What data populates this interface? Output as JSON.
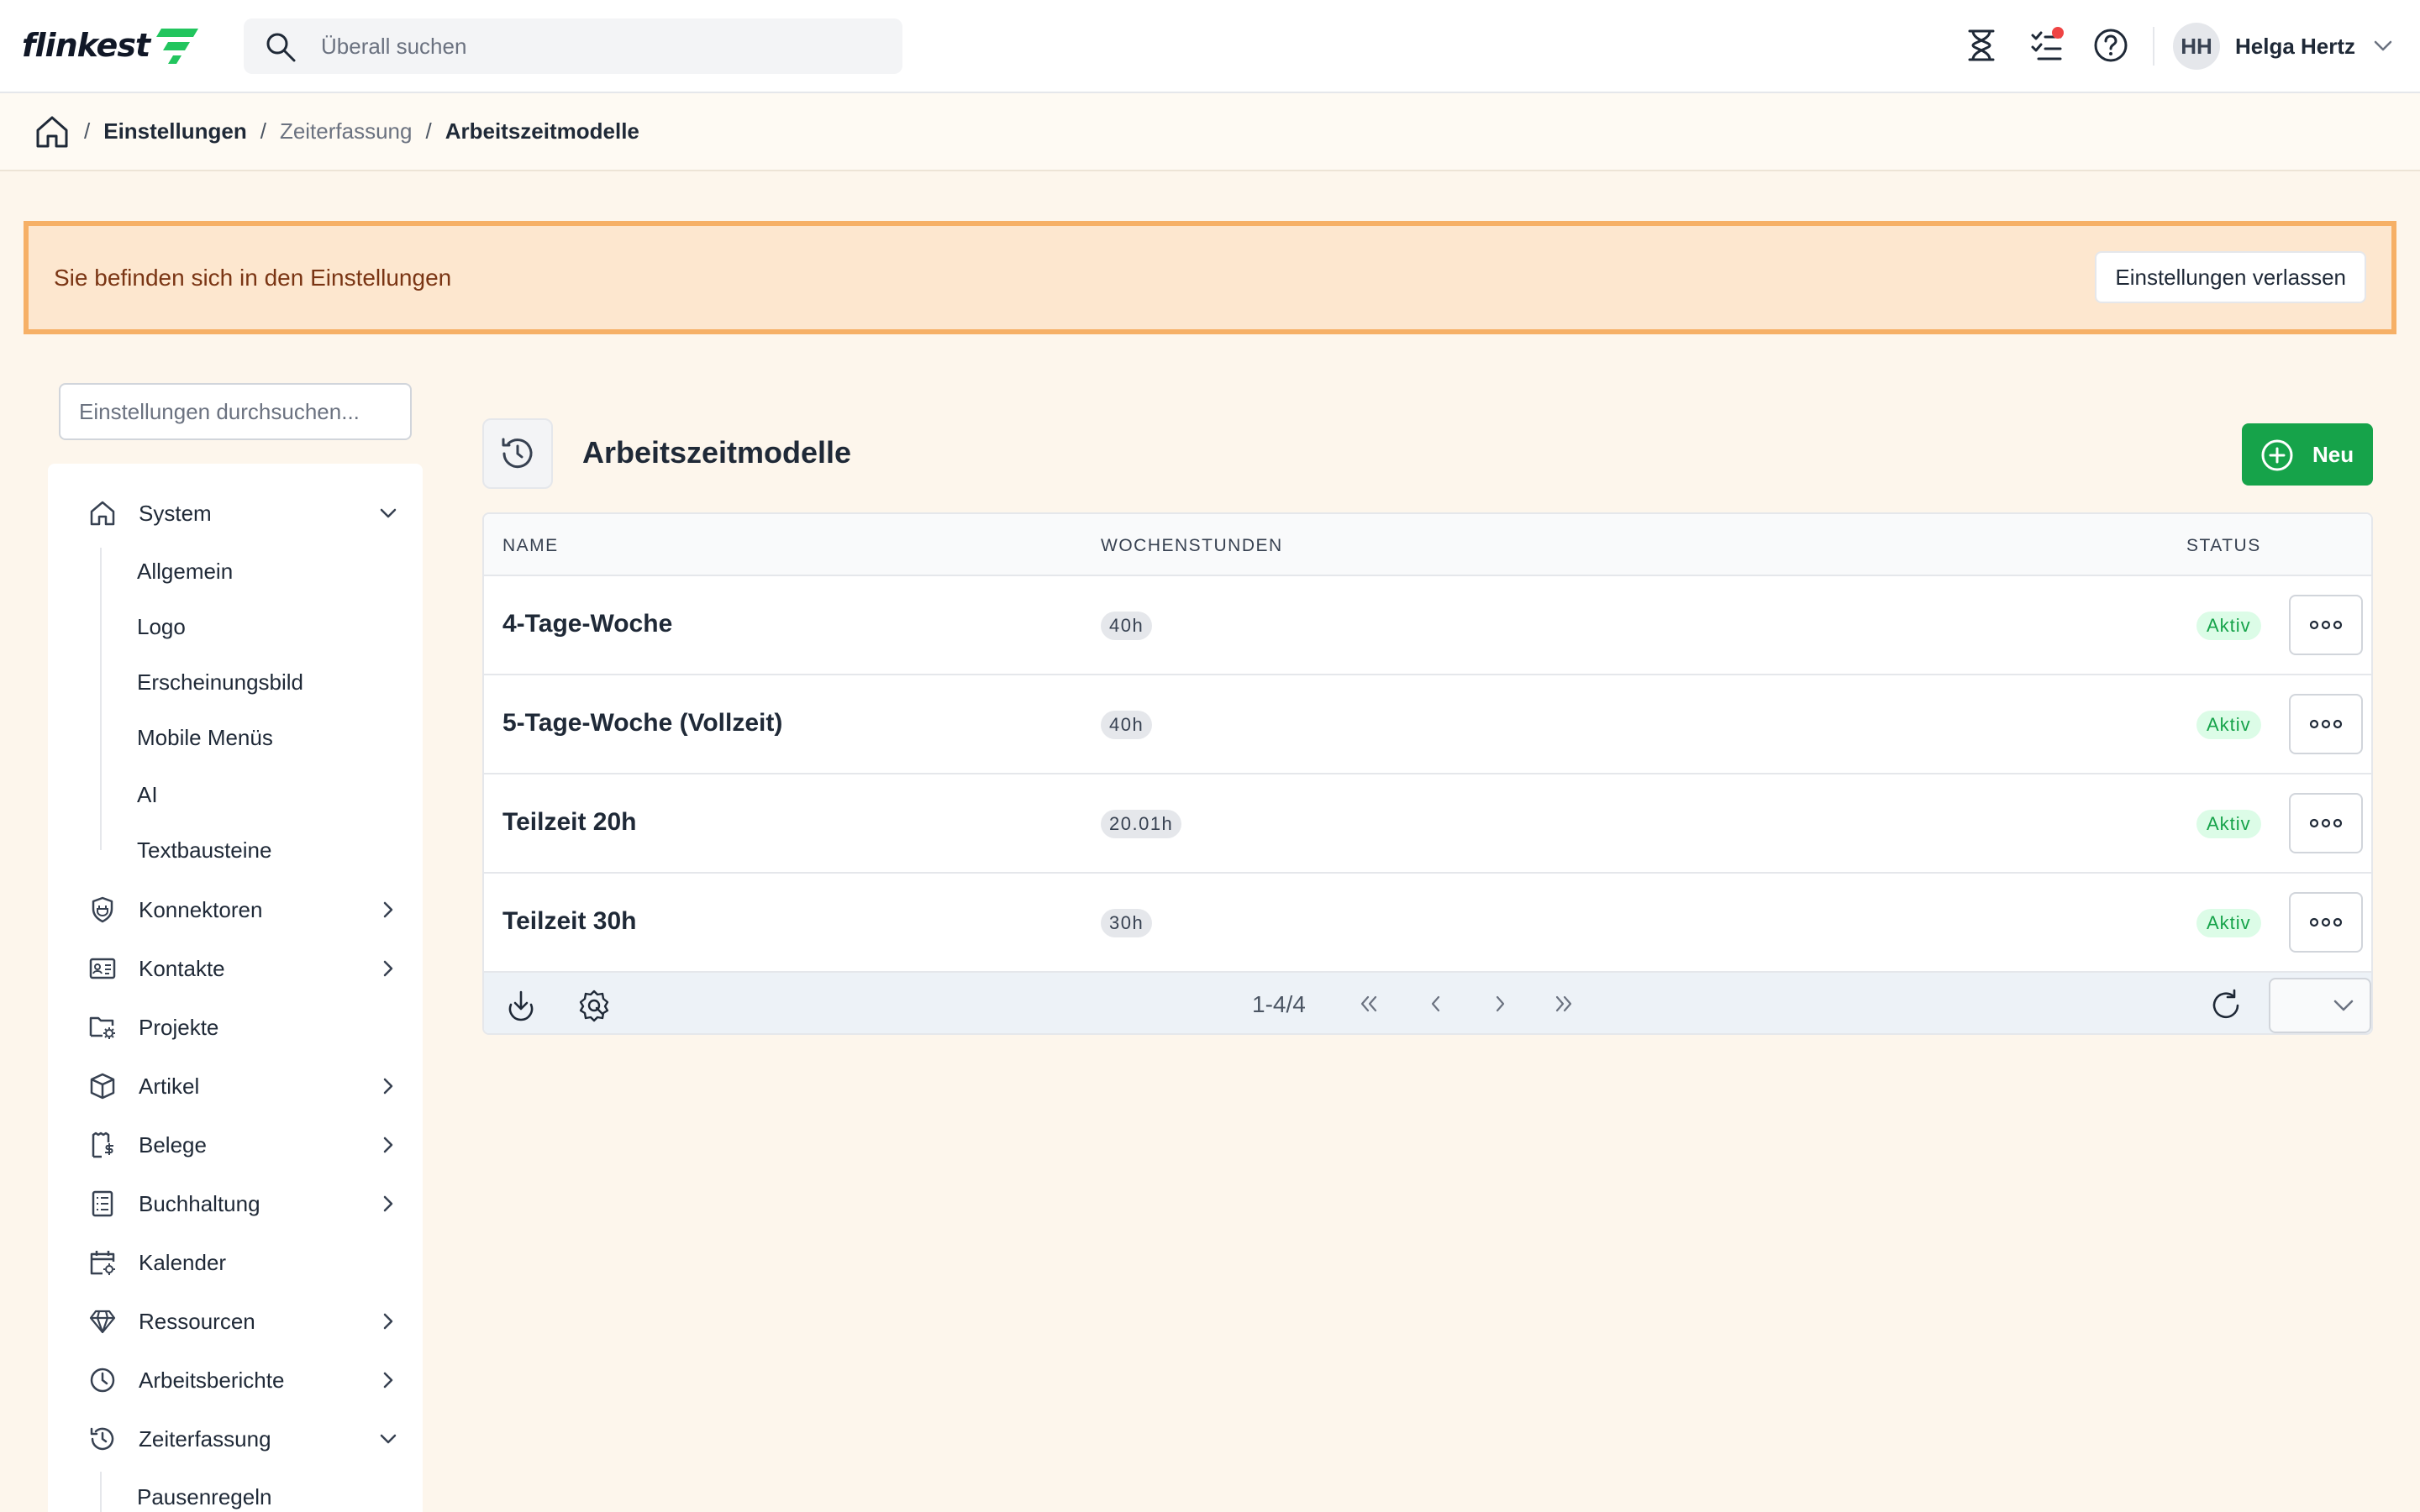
{
  "app": {
    "logo_text": "flinkest",
    "brand_color": "#22c55e"
  },
  "header": {
    "search_placeholder": "Überall suchen",
    "icons": [
      "hourglass-icon",
      "tasks-icon",
      "help-icon"
    ],
    "user": {
      "initials": "HH",
      "name": "Helga Hertz"
    }
  },
  "breadcrumb": {
    "items": [
      "Einstellungen",
      "Zeiterfassung",
      "Arbeitszeitmodelle"
    ]
  },
  "notice": {
    "text": "Sie befinden sich in den Einstellungen",
    "button_label": "Einstellungen verlassen"
  },
  "sidebar": {
    "search_placeholder": "Einstellungen durchsuchen...",
    "system": {
      "label": "System",
      "children": [
        "Allgemein",
        "Logo",
        "Erscheinungsbild",
        "Mobile Menüs",
        "AI",
        "Textbausteine"
      ]
    },
    "items": [
      {
        "label": "Konnektoren",
        "icon": "plug-shield-icon",
        "expandable": true
      },
      {
        "label": "Kontakte",
        "icon": "contact-card-icon",
        "expandable": true
      },
      {
        "label": "Projekte",
        "icon": "folder-gear-icon",
        "expandable": false
      },
      {
        "label": "Artikel",
        "icon": "box-icon",
        "expandable": true
      },
      {
        "label": "Belege",
        "icon": "receipt-icon",
        "expandable": true
      },
      {
        "label": "Buchhaltung",
        "icon": "ledger-icon",
        "expandable": true
      },
      {
        "label": "Kalender",
        "icon": "calendar-gear-icon",
        "expandable": false
      },
      {
        "label": "Ressourcen",
        "icon": "diamond-icon",
        "expandable": true
      },
      {
        "label": "Arbeitsberichte",
        "icon": "clock-icon",
        "expandable": true
      }
    ],
    "zeiterfassung": {
      "label": "Zeiterfassung",
      "children": [
        "Pausenregeln"
      ]
    }
  },
  "main": {
    "title": "Arbeitszeitmodelle",
    "new_button_label": "Neu",
    "table": {
      "columns": [
        "NAME",
        "WOCHENSTUNDEN",
        "STATUS"
      ],
      "rows": [
        {
          "name": "4-Tage-Woche",
          "hours": "40h",
          "status": "Aktiv"
        },
        {
          "name": "5-Tage-Woche (Vollzeit)",
          "hours": "40h",
          "status": "Aktiv"
        },
        {
          "name": "Teilzeit 20h",
          "hours": "20.01h",
          "status": "Aktiv"
        },
        {
          "name": "Teilzeit 30h",
          "hours": "30h",
          "status": "Aktiv"
        }
      ],
      "pagination": {
        "info": "1-4/4"
      }
    }
  }
}
